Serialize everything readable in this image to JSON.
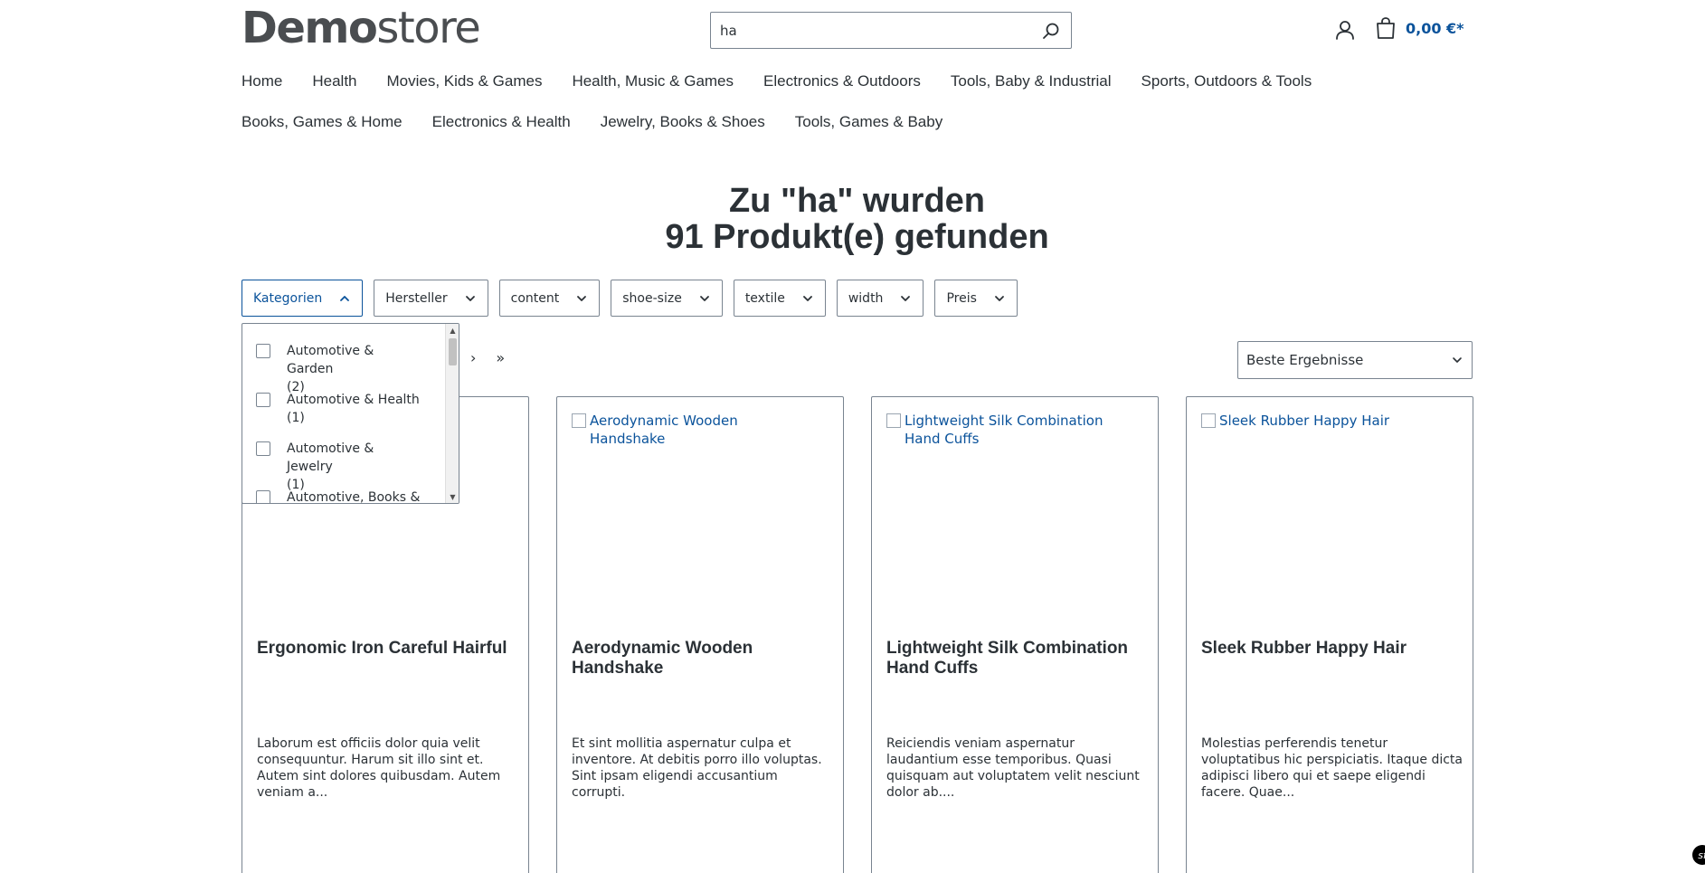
{
  "header": {
    "logo_bold": "Demo",
    "logo_light": "store",
    "search_value": "ha",
    "cart_total": "0,00 €*"
  },
  "nav": {
    "row1": [
      "Home",
      "Health",
      "Movies, Kids & Games",
      "Health, Music & Games",
      "Electronics & Outdoors",
      "Tools, Baby & Industrial",
      "Sports, Outdoors & Tools"
    ],
    "row2": [
      "Books, Games & Home",
      "Electronics & Health",
      "Jewelry, Books & Shoes",
      "Tools, Games & Baby"
    ]
  },
  "results": {
    "title_line1": "Zu \"ha\" wurden",
    "title_line2": "91 Produkt(e) gefunden"
  },
  "filters": [
    "Kategorien",
    "Hersteller",
    "content",
    "shoe-size",
    "textile",
    "width",
    "Preis"
  ],
  "category_dropdown": {
    "items": [
      {
        "label": "Automotive & Garden",
        "count": "(2)"
      },
      {
        "label": "Automotive & Health",
        "count": "(1)"
      },
      {
        "label": "Automotive & Jewelry",
        "count": "(1)"
      },
      {
        "label": "Automotive, Books &",
        "count": ""
      }
    ]
  },
  "pagination": {
    "next": "›",
    "last": "»"
  },
  "sort": {
    "selected": "Beste Ergebnisse"
  },
  "products": [
    {
      "image_alt": "",
      "name": "Ergonomic Iron Careful Hairful",
      "description": "Laborum est officiis dolor quia velit consequuntur. Harum sit illo sint et. Autem sint dolores quibusdam. Autem veniam a..."
    },
    {
      "image_alt": "Aerodynamic Wooden Handshake",
      "name": "Aerodynamic Wooden Handshake",
      "description": "Et sint mollitia aspernatur culpa et inventore. At debitis porro illo voluptas. Sint ipsam eligendi accusantium corrupti."
    },
    {
      "image_alt": "Lightweight Silk Combination Hand Cuffs",
      "name": "Lightweight Silk Combination Hand Cuffs",
      "description": "Reiciendis veniam aspernatur laudantium esse temporibus. Quasi quisquam aut voluptatem velit nesciunt dolor ab...."
    },
    {
      "image_alt": "Sleek Rubber Happy Hair",
      "name": "Sleek Rubber Happy Hair",
      "description": "Molestias perferendis tenetur voluptatibus hic perspiciatis. Itaque dicta adipisci libero qui et saepe eligendi facere. Quae..."
    }
  ],
  "colors": {
    "accent": "#0b539b",
    "text": "#2b3136",
    "border": "#798490"
  }
}
